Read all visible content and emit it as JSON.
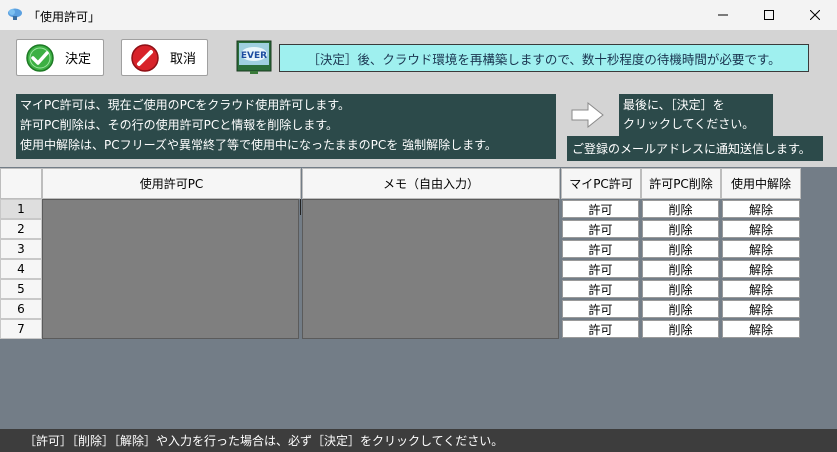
{
  "window": {
    "title": "「使用許可」"
  },
  "toolbar": {
    "ok_label": "決定",
    "cancel_label": "取消",
    "ever_logo_text": "EVER",
    "notice": "［決定］後、クラウド環境を再構築しますので、数十秒程度の待機時間が必要です。"
  },
  "info": {
    "lines": [
      "マイPC許可は、現在ご使用のPCをクラウド使用許可します。",
      "許可PC削除は、その行の使用許可PCと情報を削除します。",
      "使用中解除は、PCフリーズや異常終了等で使用中になったままのPCを 強制解除します。"
    ],
    "final_line1": "最後に、［決定］を",
    "final_line2": "クリックしてください。",
    "mail_notice": "ご登録のメールアドレスに通知送信します。"
  },
  "grid": {
    "columns": [
      "使用許可PC",
      "メモ（自由入力）",
      "マイPC許可",
      "許可PC削除",
      "使用中解除"
    ],
    "rows": [
      {
        "num": "1",
        "allow": "許可",
        "delete": "削除",
        "release": "解除"
      },
      {
        "num": "2",
        "allow": "許可",
        "delete": "削除",
        "release": "解除"
      },
      {
        "num": "3",
        "allow": "許可",
        "delete": "削除",
        "release": "解除"
      },
      {
        "num": "4",
        "allow": "許可",
        "delete": "削除",
        "release": "解除"
      },
      {
        "num": "5",
        "allow": "許可",
        "delete": "削除",
        "release": "解除"
      },
      {
        "num": "6",
        "allow": "許可",
        "delete": "削除",
        "release": "解除"
      },
      {
        "num": "7",
        "allow": "許可",
        "delete": "削除",
        "release": "解除"
      }
    ]
  },
  "status": {
    "text": "［許可］［削除］［解除］や入力を行った場合は、必ず［決定］をクリックしてください。"
  },
  "colors": {
    "panel_dark": "#2c4a4a",
    "notice_bg": "#9ff0ef",
    "grid_bg": "#737d87",
    "cell_gray": "#7f7f7f"
  }
}
